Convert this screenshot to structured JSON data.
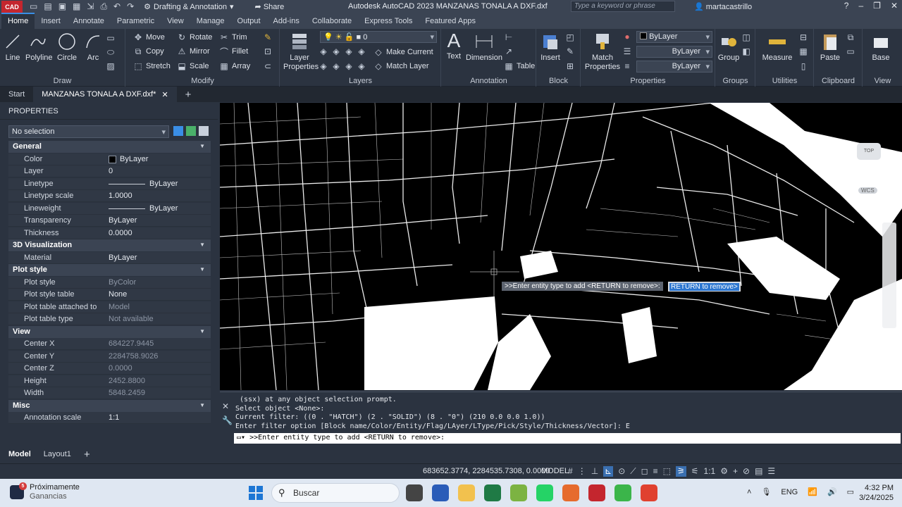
{
  "titlebar": {
    "logo": "CAD",
    "workspace": "Drafting & Annotation",
    "share": "Share",
    "app_title": "Autodesk AutoCAD 2023   MANZANAS TONALA A DXF.dxf",
    "search_placeholder": "Type a keyword or phrase",
    "user": "martacastrillo"
  },
  "ribbon_tabs": [
    "Home",
    "Insert",
    "Annotate",
    "Parametric",
    "View",
    "Manage",
    "Output",
    "Add-ins",
    "Collaborate",
    "Express Tools",
    "Featured Apps"
  ],
  "ribbon": {
    "draw": {
      "title": "Draw",
      "line": "Line",
      "polyline": "Polyline",
      "circle": "Circle",
      "arc": "Arc"
    },
    "modify": {
      "title": "Modify",
      "move": "Move",
      "rotate": "Rotate",
      "trim": "Trim",
      "copy": "Copy",
      "mirror": "Mirror",
      "fillet": "Fillet",
      "stretch": "Stretch",
      "scale": "Scale",
      "array": "Array"
    },
    "layers": {
      "title": "Layers",
      "layer_properties": "Layer Properties",
      "layer_value": "0",
      "make_current": "Make Current",
      "match_layer": "Match Layer"
    },
    "annotation": {
      "title": "Annotation",
      "text": "Text",
      "dimension": "Dimension",
      "table": "Table"
    },
    "block": {
      "title": "Block",
      "insert": "Insert"
    },
    "properties": {
      "title": "Properties",
      "match_properties": "Match Properties",
      "color": "ByLayer",
      "linetype": "ByLayer",
      "lineweight": "ByLayer"
    },
    "groups": {
      "title": "Groups",
      "group": "Group"
    },
    "utilities": {
      "title": "Utilities",
      "measure": "Measure"
    },
    "clipboard": {
      "title": "Clipboard",
      "paste": "Paste"
    },
    "view": {
      "title": "View",
      "base": "Base"
    }
  },
  "doc_tabs": {
    "start": "Start",
    "active": "MANZANAS TONALA A DXF.dxf*"
  },
  "properties": {
    "header": "PROPERTIES",
    "selection": "No selection",
    "sections": [
      {
        "title": "General",
        "rows": [
          {
            "key": "Color",
            "value": "ByLayer"
          },
          {
            "key": "Layer",
            "value": "0"
          },
          {
            "key": "Linetype",
            "value": "ByLayer"
          },
          {
            "key": "Linetype scale",
            "value": "1.0000"
          },
          {
            "key": "Lineweight",
            "value": "ByLayer"
          },
          {
            "key": "Transparency",
            "value": "ByLayer"
          },
          {
            "key": "Thickness",
            "value": "0.0000"
          }
        ]
      },
      {
        "title": "3D Visualization",
        "rows": [
          {
            "key": "Material",
            "value": "ByLayer"
          }
        ]
      },
      {
        "title": "Plot style",
        "rows": [
          {
            "key": "Plot style",
            "value": "ByColor"
          },
          {
            "key": "Plot style table",
            "value": "None"
          },
          {
            "key": "Plot table attached to",
            "value": "Model"
          },
          {
            "key": "Plot table type",
            "value": "Not available"
          }
        ]
      },
      {
        "title": "View",
        "rows": [
          {
            "key": "Center X",
            "value": "684227.9445"
          },
          {
            "key": "Center Y",
            "value": "2284758.9026"
          },
          {
            "key": "Center Z",
            "value": "0.0000"
          },
          {
            "key": "Height",
            "value": "2452.8800"
          },
          {
            "key": "Width",
            "value": "5848.2459"
          }
        ]
      },
      {
        "title": "Misc",
        "rows": [
          {
            "key": "Annotation scale",
            "value": "1:1"
          }
        ]
      }
    ]
  },
  "canvas": {
    "tooltip_prompt": ">>Enter entity type to add <RETURN to remove>:",
    "tooltip_input": "RETURN to remove>",
    "viewcube": "TOP",
    "wcs": "WCS"
  },
  "command": {
    "history": [
      " (ssx) at any object selection prompt.",
      "Select object <None>:",
      "Current filter: ((0 . \"HATCH\") (2 . \"SOLID\") (8 . \"0\") (210 0.0 0.0 1.0))",
      "Enter filter option [Block name/Color/Entity/Flag/LAyer/LType/Pick/Style/Thickness/Vector]: E"
    ],
    "input": ">>Enter entity type to add <RETURN to remove>:"
  },
  "layout_tabs": [
    "Model",
    "Layout1"
  ],
  "statusbar": {
    "coords": "683652.3774, 2284535.7308, 0.0000",
    "model": "MODEL",
    "scale": "1:1"
  },
  "taskbar": {
    "weather_title": "Próximamente",
    "weather_sub": "Ganancias",
    "badge": "5",
    "search": "Buscar",
    "lang": "ENG",
    "time": "4:32 PM",
    "date": "3/24/2025"
  }
}
